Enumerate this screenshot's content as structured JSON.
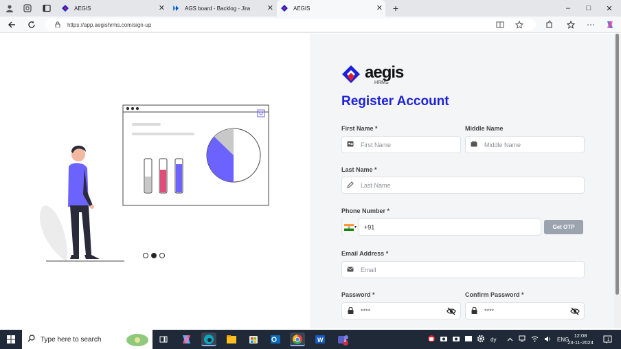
{
  "browser": {
    "tabs": [
      {
        "title": "AEGIS",
        "active": false
      },
      {
        "title": "AGS board - Backlog - Jira",
        "active": false
      },
      {
        "title": "AEGIS",
        "active": true
      }
    ],
    "new_tab_symbol": "+",
    "url": "https://app.aegishrms.com/sign-up",
    "window_controls": {
      "minimize": "–",
      "maximize": "□",
      "close": "✕"
    }
  },
  "carousel": {
    "slides": 3,
    "active_slide": 2
  },
  "brand": {
    "logo_text": "aegis",
    "logo_sub": "HRMS",
    "colors": {
      "blue": "#1d22d8",
      "red": "#e11d2a",
      "accent": "#6b63f5"
    }
  },
  "form": {
    "title": "Register Account",
    "first_name": {
      "label": "First Name *",
      "placeholder": "First Name"
    },
    "middle_name": {
      "label": "Middle Name",
      "placeholder": "Middle Name"
    },
    "last_name": {
      "label": "Last Name *",
      "placeholder": "Last Name"
    },
    "phone": {
      "label": "Phone Number *",
      "value": "+91",
      "country": "India",
      "otp_button": "Get OTP"
    },
    "email": {
      "label": "Email Address *",
      "placeholder": "Email"
    },
    "password": {
      "label": "Password *",
      "placeholder": "****"
    },
    "confirm_password": {
      "label": "Confirm Password *",
      "placeholder": "****"
    }
  },
  "taskbar": {
    "search_placeholder": "Type here to search",
    "tray_text": "dy",
    "language": "ENG",
    "time": "12:08",
    "date": "23-11-2024",
    "notification_badge": "1",
    "teams_badge": "8"
  }
}
